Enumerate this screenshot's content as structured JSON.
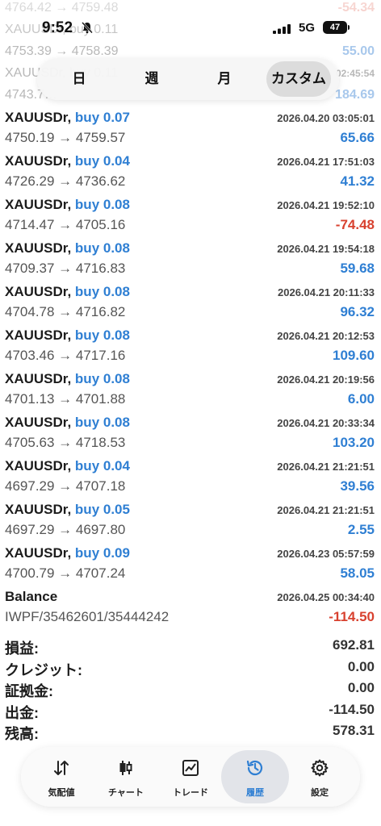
{
  "status_bar": {
    "time": "9:52",
    "network": "5G",
    "battery": "47"
  },
  "background_rows": [
    {
      "left": "4764.42 → 4759.48",
      "right": "-54.34",
      "kind": "neg"
    },
    {
      "left": "XAUUSDr, buy 0.11",
      "right": "",
      "kind": ""
    },
    {
      "left": "4753.39 → 4758.39",
      "right": "55.00",
      "kind": "pos"
    },
    {
      "left": "XAUUSDr, buy 0.11",
      "right": "02:45:54",
      "kind": "dt"
    },
    {
      "left": "4743.7…",
      "right": "184.69",
      "kind": "pos"
    }
  ],
  "period_tabs": [
    {
      "label": "日",
      "active": false
    },
    {
      "label": "週",
      "active": false
    },
    {
      "label": "月",
      "active": false
    },
    {
      "label": "カスタム",
      "active": true
    }
  ],
  "trades": [
    {
      "symbol": "XAUUSDr,",
      "side": "buy 0.07",
      "datetime": "2026.04.20 03:05:01",
      "prices": "4750.19 → 4759.57",
      "profit": "65.66",
      "negative": false
    },
    {
      "symbol": "XAUUSDr,",
      "side": "buy 0.04",
      "datetime": "2026.04.21 17:51:03",
      "prices": "4726.29 → 4736.62",
      "profit": "41.32",
      "negative": false
    },
    {
      "symbol": "XAUUSDr,",
      "side": "buy 0.08",
      "datetime": "2026.04.21 19:52:10",
      "prices": "4714.47 → 4705.16",
      "profit": "-74.48",
      "negative": true
    },
    {
      "symbol": "XAUUSDr,",
      "side": "buy 0.08",
      "datetime": "2026.04.21 19:54:18",
      "prices": "4709.37 → 4716.83",
      "profit": "59.68",
      "negative": false
    },
    {
      "symbol": "XAUUSDr,",
      "side": "buy 0.08",
      "datetime": "2026.04.21 20:11:33",
      "prices": "4704.78 → 4716.82",
      "profit": "96.32",
      "negative": false
    },
    {
      "symbol": "XAUUSDr,",
      "side": "buy 0.08",
      "datetime": "2026.04.21 20:12:53",
      "prices": "4703.46 → 4717.16",
      "profit": "109.60",
      "negative": false
    },
    {
      "symbol": "XAUUSDr,",
      "side": "buy 0.08",
      "datetime": "2026.04.21 20:19:56",
      "prices": "4701.13 → 4701.88",
      "profit": "6.00",
      "negative": false
    },
    {
      "symbol": "XAUUSDr,",
      "side": "buy 0.08",
      "datetime": "2026.04.21 20:33:34",
      "prices": "4705.63 → 4718.53",
      "profit": "103.20",
      "negative": false
    },
    {
      "symbol": "XAUUSDr,",
      "side": "buy 0.04",
      "datetime": "2026.04.21 21:21:51",
      "prices": "4697.29 → 4707.18",
      "profit": "39.56",
      "negative": false
    },
    {
      "symbol": "XAUUSDr,",
      "side": "buy 0.05",
      "datetime": "2026.04.21 21:21:51",
      "prices": "4697.29 → 4697.80",
      "profit": "2.55",
      "negative": false
    },
    {
      "symbol": "XAUUSDr,",
      "side": "buy 0.09",
      "datetime": "2026.04.23 05:57:59",
      "prices": "4700.79 → 4707.24",
      "profit": "58.05",
      "negative": false
    },
    {
      "symbol": "Balance",
      "side": "",
      "datetime": "2026.04.25 00:34:40",
      "prices": "IWPF/35462601/35444242",
      "profit": "-114.50",
      "negative": true
    }
  ],
  "summary": [
    {
      "label": "損益:",
      "value": "692.81"
    },
    {
      "label": "クレジット:",
      "value": "0.00"
    },
    {
      "label": "証拠金:",
      "value": "0.00"
    },
    {
      "label": "出金:",
      "value": "-114.50"
    },
    {
      "label": "残高:",
      "value": "578.31"
    }
  ],
  "tabs": [
    {
      "label": "気配値",
      "icon": "arrows-up-down-icon",
      "active": false
    },
    {
      "label": "チャート",
      "icon": "candlestick-icon",
      "active": false
    },
    {
      "label": "トレード",
      "icon": "trade-chart-icon",
      "active": false
    },
    {
      "label": "履歴",
      "icon": "history-icon",
      "active": true
    },
    {
      "label": "設定",
      "icon": "gear-icon",
      "active": false
    }
  ],
  "colors": {
    "accent": "#2f7fd3",
    "negative": "#d8412f"
  }
}
